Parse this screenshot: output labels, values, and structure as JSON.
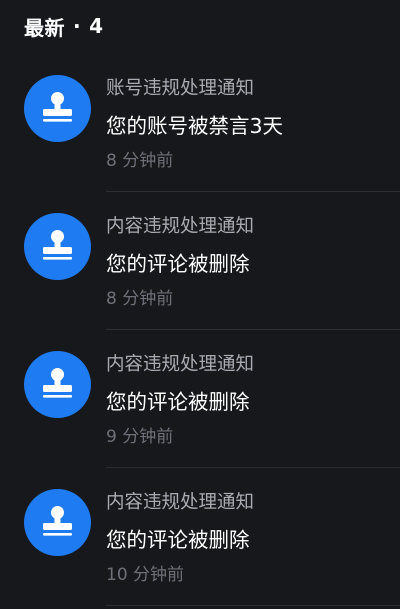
{
  "header": {
    "title": "最新",
    "separator": "·",
    "count": "4"
  },
  "notifications": [
    {
      "icon": "stamp-icon",
      "sender": "账号违规处理通知",
      "message": "您的账号被禁言3天",
      "time": "8 分钟前"
    },
    {
      "icon": "stamp-icon",
      "sender": "内容违规处理通知",
      "message": "您的评论被删除",
      "time": "8 分钟前"
    },
    {
      "icon": "stamp-icon",
      "sender": "内容违规处理通知",
      "message": "您的评论被删除",
      "time": "9 分钟前"
    },
    {
      "icon": "stamp-icon",
      "sender": "内容违规处理通知",
      "message": "您的评论被删除",
      "time": "10 分钟前"
    }
  ],
  "colors": {
    "background": "#17181c",
    "avatar": "#1f7bf2",
    "sender_text": "#a9abb3",
    "time_text": "#6d7079"
  }
}
